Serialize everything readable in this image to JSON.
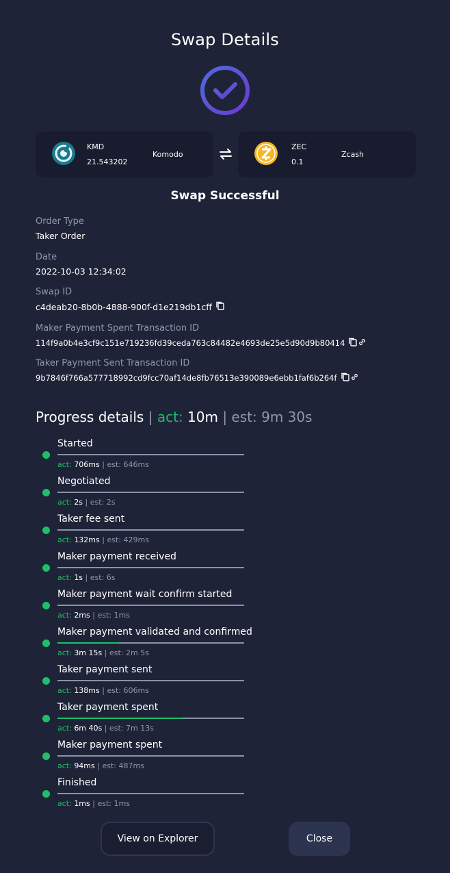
{
  "header": {
    "title": "Swap Details"
  },
  "icons": {
    "success": "check-circle-icon",
    "swap": "swap-arrows-icon",
    "copy": "copy-icon",
    "link": "link-icon"
  },
  "colors": {
    "background": "#1f2337",
    "card": "#191c2e",
    "accent_green": "#1dbf6a",
    "check_gradient_start": "#4f6bdb",
    "check_gradient_end": "#6a3ad0"
  },
  "from_coin": {
    "ticker": "KMD",
    "amount": "21.543202",
    "name": "Komodo",
    "icon": "komodo-logo-icon"
  },
  "to_coin": {
    "ticker": "ZEC",
    "amount": "0.1",
    "name": "Zcash",
    "icon": "zcash-logo-icon"
  },
  "status": "Swap Successful",
  "details": {
    "order_type_label": "Order Type",
    "order_type": "Taker Order",
    "date_label": "Date",
    "date": "2022-10-03 12:34:02",
    "swap_id_label": "Swap ID",
    "swap_id": "c4deab20-8b0b-4888-900f-d1e219db1cff",
    "maker_tx_label": "Maker Payment Spent Transaction ID",
    "maker_tx": "114f9a0b4e3cf9c151e719236fd39ceda763c84482e4693de25e5d90d9b80414",
    "taker_tx_label": "Taker Payment Sent Transaction ID",
    "taker_tx": "9b7846f766a577718992cd9fcc70af14de8fb76513e390089e6ebb1faf6b264f"
  },
  "progress": {
    "title": "Progress details",
    "separator": "|",
    "act_label": "act:",
    "act_value": "10m",
    "est_label": "est:",
    "est_value": "9m 30s"
  },
  "steps": [
    {
      "label": "Started",
      "act_label": "act:",
      "act": "706ms",
      "sep": "|",
      "est": "est: 646ms",
      "fill": 0
    },
    {
      "label": "Negotiated",
      "act_label": "act:",
      "act": "2s",
      "sep": "|",
      "est": "est: 2s",
      "fill": 0
    },
    {
      "label": "Taker fee sent",
      "act_label": "act:",
      "act": "132ms",
      "sep": "|",
      "est": "est: 429ms",
      "fill": 0
    },
    {
      "label": "Maker payment received",
      "act_label": "act:",
      "act": "1s",
      "sep": "|",
      "est": "est: 6s",
      "fill": 0
    },
    {
      "label": "Maker payment wait confirm started",
      "act_label": "act:",
      "act": "2ms",
      "sep": "|",
      "est": "est: 1ms",
      "fill": 0
    },
    {
      "label": "Maker payment validated and confirmed",
      "act_label": "act:",
      "act": "3m 15s",
      "sep": "|",
      "est": "est: 2m 5s",
      "fill": 0.33
    },
    {
      "label": "Taker payment sent",
      "act_label": "act:",
      "act": "138ms",
      "sep": "|",
      "est": "est: 606ms",
      "fill": 0
    },
    {
      "label": "Taker payment spent",
      "act_label": "act:",
      "act": "6m 40s",
      "sep": "|",
      "est": "est: 7m 13s",
      "fill": 0.67
    },
    {
      "label": "Maker payment spent",
      "act_label": "act:",
      "act": "94ms",
      "sep": "|",
      "est": "est: 487ms",
      "fill": 0
    },
    {
      "label": "Finished",
      "act_label": "act:",
      "act": "1ms",
      "sep": "|",
      "est": "est: 1ms",
      "fill": 0
    }
  ],
  "buttons": {
    "explorer": "View on Explorer",
    "close": "Close"
  }
}
